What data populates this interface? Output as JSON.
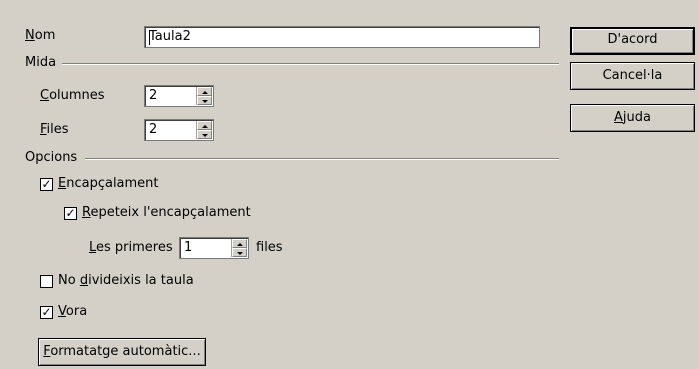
{
  "name": {
    "label_ul": "N",
    "label_rest": "om",
    "value_first": "T",
    "value_rest": "aula2"
  },
  "size": {
    "title": "Mida",
    "columns": {
      "label_ul": "C",
      "label_rest": "olumnes",
      "value": "2"
    },
    "rows": {
      "label_ul": "F",
      "label_rest": "iles",
      "value": "2"
    }
  },
  "options": {
    "title": "Opcions",
    "heading": {
      "label_ul": "E",
      "label_rest": "ncapçalament",
      "checked": true
    },
    "repeat": {
      "label_ul": "R",
      "label_rest": "epeteix l'encapçalament",
      "checked": true
    },
    "first": {
      "label_ul": "L",
      "label_rest": "es primeres",
      "value": "1",
      "suffix": "files"
    },
    "no_split": {
      "label_pre": "No ",
      "label_ul": "d",
      "label_rest": "ivideixis la taula",
      "checked": false
    },
    "border": {
      "label_ul": "V",
      "label_rest": "ora",
      "checked": true
    },
    "autoformat": {
      "label_ul": "F",
      "label_rest": "ormatatge automàtic..."
    }
  },
  "buttons": {
    "ok": "D'acord",
    "cancel": "Cancel·la",
    "help_ul": "A",
    "help_rest": "juda"
  },
  "icons": {
    "checked": "check-mark",
    "spin": "spin-arrows"
  }
}
